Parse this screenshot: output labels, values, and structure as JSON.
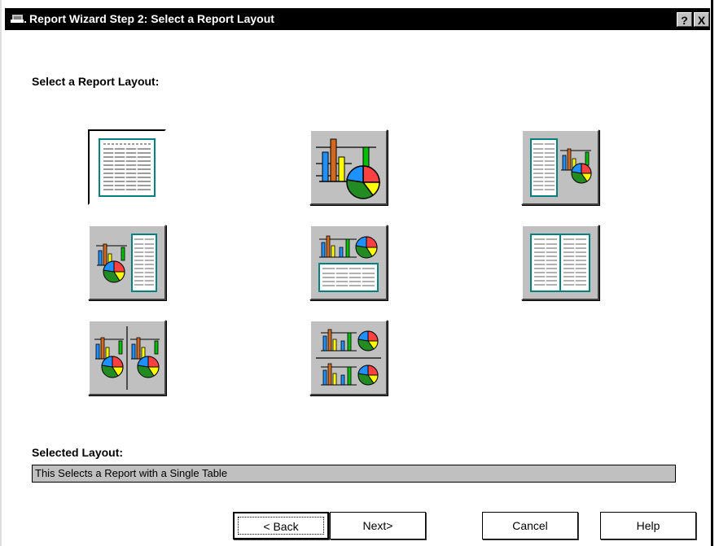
{
  "window": {
    "title": "Report Wizard Step 2: Select a Report Layout",
    "help_button": "?",
    "close_button": "X"
  },
  "select_label": "Select a Report Layout:",
  "layouts": [
    {
      "id": "single-table",
      "icon": "table-icon",
      "selected": true
    },
    {
      "id": "single-chart",
      "icon": "chart-icon",
      "selected": false
    },
    {
      "id": "table-chart",
      "icon": "table-chart-icon",
      "selected": false
    },
    {
      "id": "chart-table",
      "icon": "chart-table-icon",
      "selected": false
    },
    {
      "id": "chart-over-table",
      "icon": "chart-over-table-icon",
      "selected": false
    },
    {
      "id": "two-tables",
      "icon": "two-tables-icon",
      "selected": false
    },
    {
      "id": "two-charts-side",
      "icon": "two-charts-side-icon",
      "selected": false
    },
    {
      "id": "two-charts-stacked",
      "icon": "two-charts-stacked-icon",
      "selected": false
    }
  ],
  "selected_layout": {
    "label": "Selected Layout:",
    "description": "This Selects a Report with a Single Table"
  },
  "buttons": {
    "back": "< Back",
    "next": "Next>",
    "cancel": "Cancel",
    "help": "Help"
  },
  "colors": {
    "titlebar": "#000000",
    "button_face": "#c0c0c0",
    "table_accent": "#008080",
    "chart_orange": "#d2691e",
    "chart_blue": "#1e90ff",
    "chart_yellow": "#ffff00",
    "chart_green": "#228b22",
    "chart_red": "#ff4040"
  }
}
